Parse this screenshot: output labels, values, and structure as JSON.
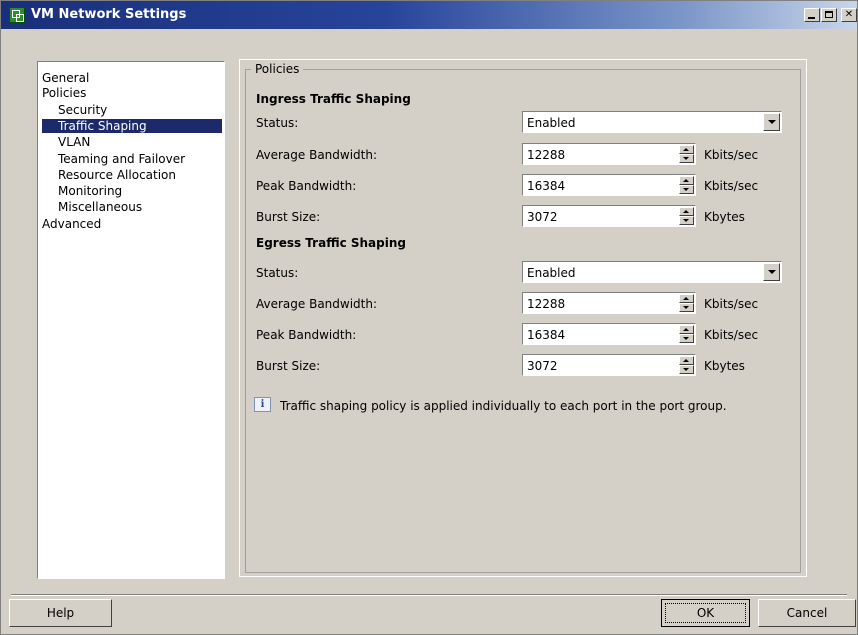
{
  "window": {
    "title": "VM Network Settings"
  },
  "nav": {
    "items": [
      {
        "label": "General",
        "level": 0,
        "selected": false
      },
      {
        "label": "Policies",
        "level": 0,
        "selected": false
      },
      {
        "label": "Security",
        "level": 1,
        "selected": false
      },
      {
        "label": "Traffic Shaping",
        "level": 1,
        "selected": true
      },
      {
        "label": "VLAN",
        "level": 1,
        "selected": false
      },
      {
        "label": "Teaming and Failover",
        "level": 1,
        "selected": false
      },
      {
        "label": "Resource Allocation",
        "level": 1,
        "selected": false
      },
      {
        "label": "Monitoring",
        "level": 1,
        "selected": false
      },
      {
        "label": "Miscellaneous",
        "level": 1,
        "selected": false
      },
      {
        "label": "Advanced",
        "level": 0,
        "selected": false
      }
    ]
  },
  "policies": {
    "group_label": "Policies",
    "ingress": {
      "title": "Ingress Traffic Shaping",
      "status_label": "Status:",
      "status_value": "Enabled",
      "avg_label": "Average Bandwidth:",
      "avg_value": "12288",
      "avg_unit": "Kbits/sec",
      "peak_label": "Peak Bandwidth:",
      "peak_value": "16384",
      "peak_unit": "Kbits/sec",
      "burst_label": "Burst Size:",
      "burst_value": "3072",
      "burst_unit": "Kbytes"
    },
    "egress": {
      "title": "Egress Traffic Shaping",
      "status_label": "Status:",
      "status_value": "Enabled",
      "avg_label": "Average Bandwidth:",
      "avg_value": "12288",
      "avg_unit": "Kbits/sec",
      "peak_label": "Peak Bandwidth:",
      "peak_value": "16384",
      "peak_unit": "Kbits/sec",
      "burst_label": "Burst Size:",
      "burst_value": "3072",
      "burst_unit": "Kbytes"
    },
    "info_text": "Traffic shaping policy is applied individually to each port in the port group."
  },
  "buttons": {
    "help": "Help",
    "ok": "OK",
    "cancel": "Cancel"
  },
  "colors": {
    "titlebar": "#27449b",
    "selection": "#1c2a6b",
    "dialog_bg": "#d4d0c8"
  },
  "icons": {
    "app": "vm-network-icon",
    "info": "info-icon"
  }
}
